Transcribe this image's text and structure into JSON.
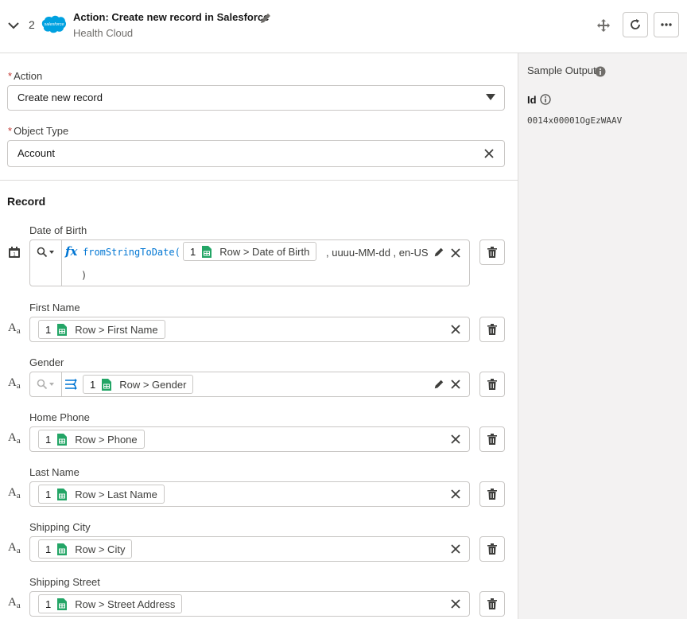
{
  "header": {
    "step_number": "2",
    "logo_text": "salesforce",
    "title": "Action: Create new record in Salesforce",
    "subtitle": "Health Cloud"
  },
  "form": {
    "action_label": "Action",
    "action_value": "Create new record",
    "object_type_label": "Object Type",
    "object_type_value": "Account",
    "record_title": "Record"
  },
  "fields": [
    {
      "label": "Date of Birth",
      "type_icon": "calendar-icon",
      "pill_num": "1",
      "pill_text": "Row > Date of Birth",
      "formula_fn": "fromStringToDate(",
      "formula_args": ", uuuu-MM-dd , en-US",
      "formula_close": ")"
    },
    {
      "label": "First Name",
      "type_icon": "text-icon",
      "pill_num": "1",
      "pill_text": "Row > First Name"
    },
    {
      "label": "Gender",
      "type_icon": "text-icon",
      "pill_num": "1",
      "pill_text": "Row > Gender"
    },
    {
      "label": "Home Phone",
      "type_icon": "text-icon",
      "pill_num": "1",
      "pill_text": "Row > Phone"
    },
    {
      "label": "Last Name",
      "type_icon": "text-icon",
      "pill_num": "1",
      "pill_text": "Row > Last Name"
    },
    {
      "label": "Shipping City",
      "type_icon": "text-icon",
      "pill_num": "1",
      "pill_text": "Row > City"
    },
    {
      "label": "Shipping Street",
      "type_icon": "text-icon",
      "pill_num": "1",
      "pill_text": "Row > Street Address"
    }
  ],
  "sample_output": {
    "title": "Sample Output",
    "id_label": "Id",
    "id_value": "0014x00001OgEzWAAV"
  },
  "colors": {
    "brand_blue": "#00a1e0",
    "sheet_green": "#23a566",
    "required_red": "#c23934"
  }
}
